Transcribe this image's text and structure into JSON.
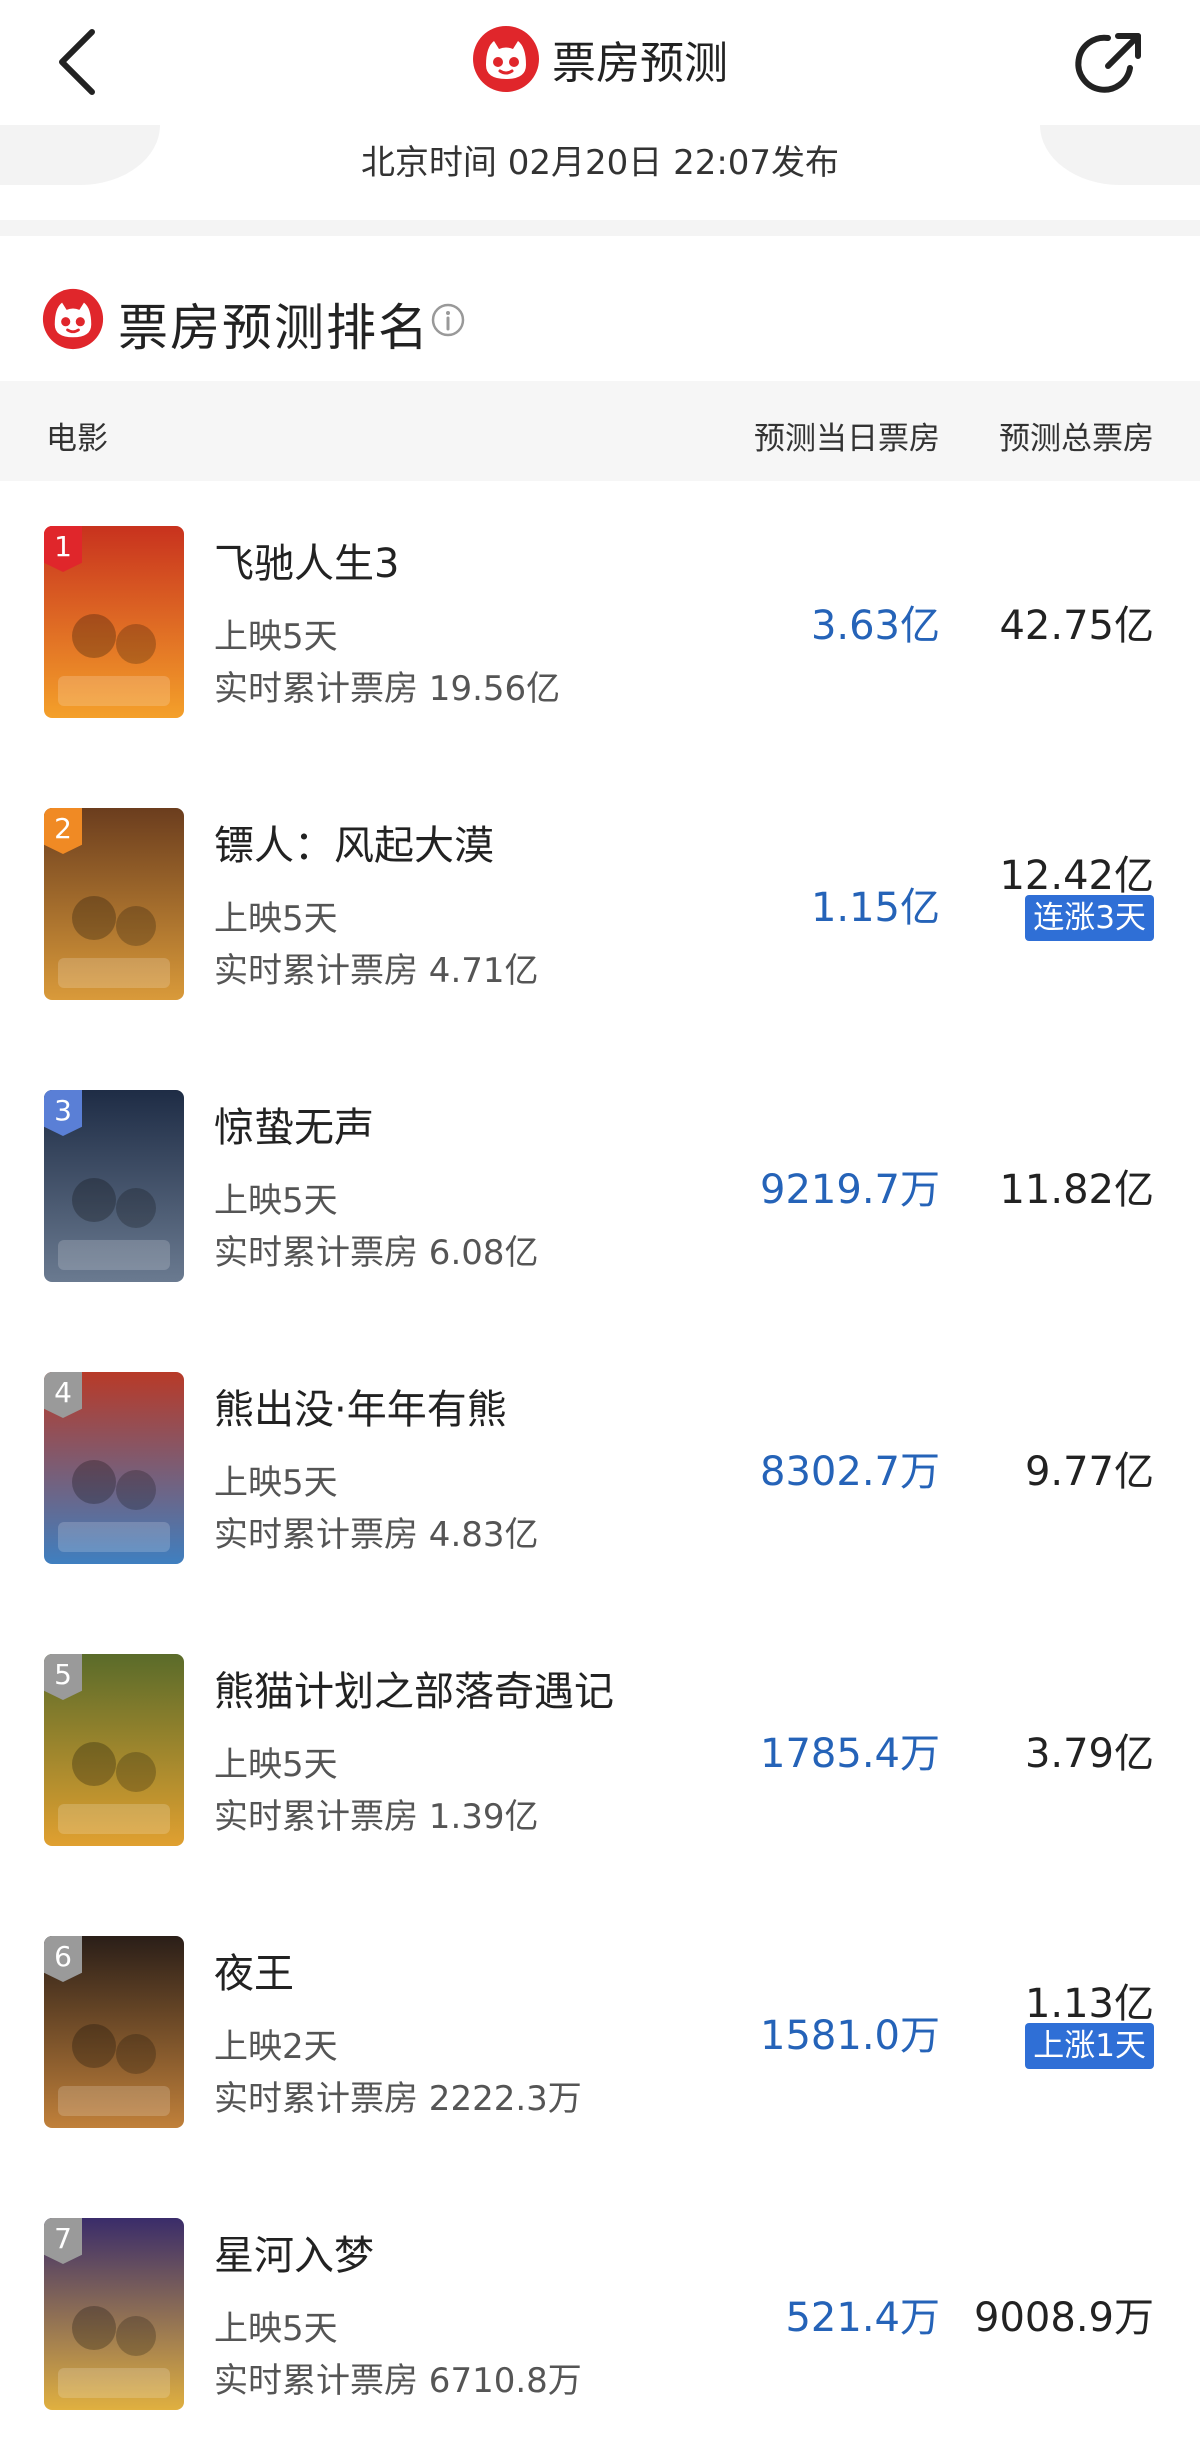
{
  "header": {
    "title": "票房预测",
    "publish_time": "北京时间  02月20日  22:07发布"
  },
  "section": {
    "title": "票房预测排名"
  },
  "table": {
    "col_movie": "电影",
    "col_daily": "预测当日票房",
    "col_total": "预测总票房"
  },
  "colors": {
    "brand_red": "#e0262b",
    "value_blue": "#2563b8",
    "badge_blue": "#2f6fd6"
  },
  "movies": [
    {
      "rank": "1",
      "name": "飞驰人生3",
      "days": "上映5天",
      "cumulative": "实时累计票房 19.56亿",
      "daily": "3.63亿",
      "total": "42.75亿",
      "trend": "",
      "badge_color": "#e0262b"
    },
    {
      "rank": "2",
      "name": "镖人：风起大漠",
      "days": "上映5天",
      "cumulative": "实时累计票房 4.71亿",
      "daily": "1.15亿",
      "total": "12.42亿",
      "trend": "连涨3天",
      "badge_color": "#f08a24"
    },
    {
      "rank": "3",
      "name": "惊蛰无声",
      "days": "上映5天",
      "cumulative": "实时累计票房 6.08亿",
      "daily": "9219.7万",
      "total": "11.82亿",
      "trend": "",
      "badge_color": "#5a7fd6"
    },
    {
      "rank": "4",
      "name": "熊出没·年年有熊",
      "days": "上映5天",
      "cumulative": "实时累计票房 4.83亿",
      "daily": "8302.7万",
      "total": "9.77亿",
      "trend": "",
      "badge_color": "#9a9a9a"
    },
    {
      "rank": "5",
      "name": "熊猫计划之部落奇遇记",
      "days": "上映5天",
      "cumulative": "实时累计票房 1.39亿",
      "daily": "1785.4万",
      "total": "3.79亿",
      "trend": "",
      "badge_color": "#9a9a9a"
    },
    {
      "rank": "6",
      "name": "夜王",
      "days": "上映2天",
      "cumulative": "实时累计票房 2222.3万",
      "daily": "1581.0万",
      "total": "1.13亿",
      "trend": "上涨1天",
      "badge_color": "#9a9a9a"
    },
    {
      "rank": "7",
      "name": "星河入梦",
      "days": "上映5天",
      "cumulative": "实时累计票房 6710.8万",
      "daily": "521.4万",
      "total": "9008.9万",
      "trend": "",
      "badge_color": "#9a9a9a"
    }
  ]
}
